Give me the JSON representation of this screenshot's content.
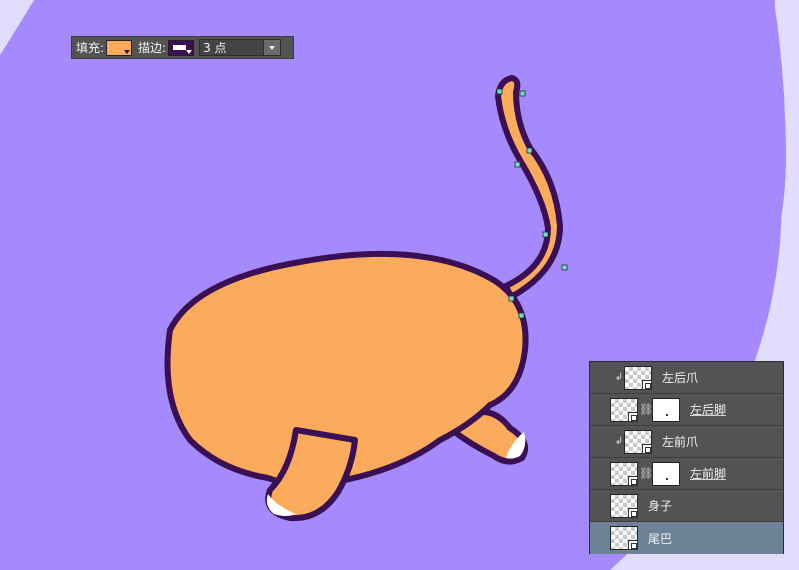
{
  "options_bar": {
    "fill_label": "填充:",
    "stroke_label": "描边:",
    "stroke_width": "3 点",
    "fill_color": "#fcab5d",
    "stroke_color": "#3b0f53"
  },
  "canvas": {
    "background": "#a48afd",
    "accent_background": "#e2dcfd",
    "body_fill": "#fcab5d",
    "outline": "#3b0f53",
    "anchor_color": "#6ee0d0"
  },
  "layers": [
    {
      "name": "左后爪",
      "clipped": true,
      "has_mask": false,
      "selected": false
    },
    {
      "name": "左后脚",
      "clipped": false,
      "has_mask": true,
      "selected": false
    },
    {
      "name": "左前爪",
      "clipped": true,
      "has_mask": false,
      "selected": false
    },
    {
      "name": "左前脚",
      "clipped": false,
      "has_mask": true,
      "selected": false
    },
    {
      "name": "身子",
      "clipped": false,
      "has_mask": false,
      "selected": false
    },
    {
      "name": "尾巴",
      "clipped": false,
      "has_mask": false,
      "selected": true
    }
  ]
}
